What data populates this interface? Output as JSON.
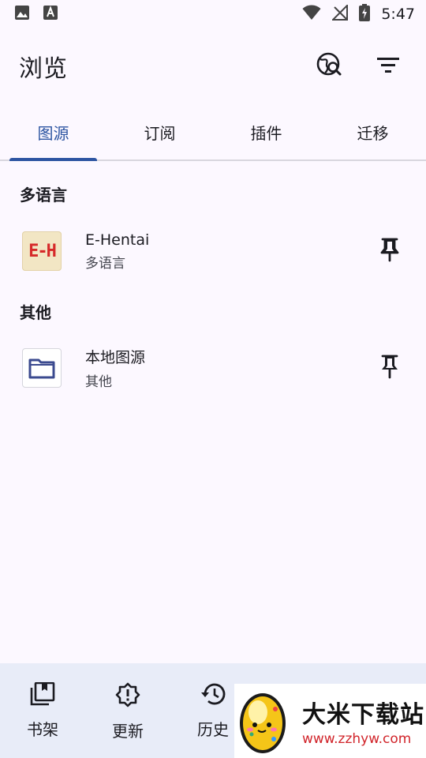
{
  "status_bar": {
    "time": "5:47",
    "left_icons": [
      "image-icon",
      "text-notification-icon"
    ],
    "right_icons": [
      "wifi-icon",
      "no-signal-icon",
      "battery-charging-icon"
    ]
  },
  "app_bar": {
    "title": "浏览",
    "actions": [
      "global-search-icon",
      "filter-icon"
    ]
  },
  "tabs": [
    {
      "label": "图源",
      "active": true
    },
    {
      "label": "订阅",
      "active": false
    },
    {
      "label": "插件",
      "active": false
    },
    {
      "label": "迁移",
      "active": false
    }
  ],
  "sections": [
    {
      "header": "多语言",
      "items": [
        {
          "name": "E-Hentai",
          "lang": "多语言",
          "icon": "e-hentai-logo",
          "logo_text": "E-H"
        }
      ]
    },
    {
      "header": "其他",
      "items": [
        {
          "name": "本地图源",
          "lang": "其他",
          "icon": "folder-icon"
        }
      ]
    }
  ],
  "bottom_nav": [
    {
      "label": "书架",
      "icon": "library-icon"
    },
    {
      "label": "更新",
      "icon": "updates-icon"
    },
    {
      "label": "历史",
      "icon": "history-icon"
    }
  ],
  "watermark": {
    "title": "大米下载站",
    "url": "www.zzhyw.com"
  },
  "colors": {
    "accent": "#2d55a2",
    "background": "#fcf8ff",
    "bottom_nav": "#e8ecf8",
    "logo_red": "#d62a2a"
  }
}
